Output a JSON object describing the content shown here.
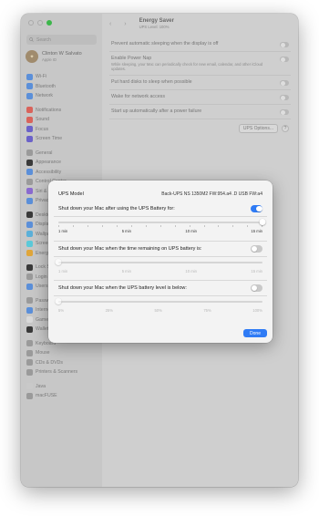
{
  "window": {
    "title": "Energy Saver",
    "subtitle": "UPS Level: 100%"
  },
  "sidebar": {
    "search_placeholder": "Search",
    "account": {
      "name": "Clinton W Salvato",
      "sub": "Apple ID"
    },
    "groups": [
      [
        {
          "label": "Wi-Fi",
          "icon": "wifi-icon",
          "color": "#5b8fd9"
        },
        {
          "label": "Bluetooth",
          "icon": "bluetooth-icon",
          "color": "#5b8fd9"
        },
        {
          "label": "Network",
          "icon": "globe-icon",
          "color": "#5b8fd9"
        }
      ],
      [
        {
          "label": "Notifications",
          "icon": "bell-icon",
          "color": "#d9635b"
        },
        {
          "label": "Sound",
          "icon": "speaker-icon",
          "color": "#d9635b"
        },
        {
          "label": "Focus",
          "icon": "moon-icon",
          "color": "#6b62c9"
        },
        {
          "label": "Screen Time",
          "icon": "hourglass-icon",
          "color": "#6b62c9"
        }
      ],
      [
        {
          "label": "General",
          "icon": "gear-icon",
          "color": "#9a9a9a"
        },
        {
          "label": "Appearance",
          "icon": "appearance-icon",
          "color": "#3a3a3a"
        },
        {
          "label": "Accessibility",
          "icon": "accessibility-icon",
          "color": "#5b8fd9"
        },
        {
          "label": "Control Center",
          "icon": "control-center-icon",
          "color": "#9a9a9a"
        },
        {
          "label": "Siri & Spotlight",
          "icon": "siri-icon",
          "color": "#8a6ad0"
        },
        {
          "label": "Privacy & Security",
          "icon": "hand-icon",
          "color": "#5b8fd9"
        }
      ],
      [
        {
          "label": "Desktop & Dock",
          "icon": "dock-icon",
          "color": "#3a3a3a"
        },
        {
          "label": "Displays",
          "icon": "display-icon",
          "color": "#5b8fd9"
        },
        {
          "label": "Wallpaper",
          "icon": "wallpaper-icon",
          "color": "#5bb0d9"
        },
        {
          "label": "Screen Saver",
          "icon": "screensaver-icon",
          "color": "#5bc9d9"
        },
        {
          "label": "Energy Saver",
          "icon": "battery-icon",
          "color": "#e0a63a"
        }
      ],
      [
        {
          "label": "Lock Screen",
          "icon": "lock-icon",
          "color": "#3a3a3a"
        },
        {
          "label": "Login Password",
          "icon": "key-icon",
          "color": "#9a9a9a"
        },
        {
          "label": "Users & Groups",
          "icon": "users-icon",
          "color": "#5b8fd9"
        }
      ],
      [
        {
          "label": "Passwords",
          "icon": "password-icon",
          "color": "#9a9a9a"
        },
        {
          "label": "Internet Accounts",
          "icon": "at-icon",
          "color": "#5b8fd9"
        },
        {
          "label": "Game Center",
          "icon": "game-center-icon",
          "color": "#d9d9d9"
        },
        {
          "label": "Wallet & Apple Pay",
          "icon": "wallet-icon",
          "color": "#3a3a3a"
        }
      ],
      [
        {
          "label": "Keyboard",
          "icon": "keyboard-icon",
          "color": "#9a9a9a"
        },
        {
          "label": "Mouse",
          "icon": "mouse-icon",
          "color": "#9a9a9a"
        },
        {
          "label": "CDs & DVDs",
          "icon": "disc-icon",
          "color": "#9a9a9a"
        },
        {
          "label": "Printers & Scanners",
          "icon": "printer-icon",
          "color": "#9a9a9a"
        }
      ],
      [
        {
          "label": "Java",
          "icon": "java-icon",
          "color": "#c9c9c9"
        },
        {
          "label": "macFUSE",
          "icon": "macfuse-icon",
          "color": "#9a9a9a"
        }
      ]
    ]
  },
  "settings": {
    "rows": [
      {
        "label": "Prevent automatic sleeping when the display is off",
        "desc": ""
      },
      {
        "label": "Enable Power Nap",
        "desc": "While sleeping, your Mac can periodically check for new email, calendar, and other iCloud updates."
      },
      {
        "label": "Put hard disks to sleep when possible",
        "desc": ""
      },
      {
        "label": "Wake for network access",
        "desc": ""
      },
      {
        "label": "Start up automatically after a power failure",
        "desc": ""
      }
    ],
    "ups_options_label": "UPS Options...",
    "help_label": "?"
  },
  "sheet": {
    "ups_model_label": "UPS Model",
    "ups_model_value": "Back-UPS NS 1350M2 FW:954.a4 .D USB FW:a4",
    "option1": {
      "label": "Shut down your Mac after using the UPS Battery for:",
      "enabled": true,
      "slider_value": 1.0,
      "tick_labels": [
        "1 min",
        "5 min",
        "10 min",
        "15 min"
      ]
    },
    "option2": {
      "label": "Shut down your Mac when the time remaining on UPS battery is:",
      "enabled": false,
      "slider_value": 0.0,
      "tick_labels": [
        "1 min",
        "5 min",
        "10 min",
        "15 min"
      ]
    },
    "option3": {
      "label": "Shut down your Mac when the UPS battery level is below:",
      "enabled": false,
      "slider_value": 0.0,
      "tick_labels": [
        "5%",
        "25%",
        "50%",
        "75%",
        "100%"
      ]
    },
    "done_label": "Done"
  },
  "colors": {
    "accent": "#2f7bf5"
  }
}
